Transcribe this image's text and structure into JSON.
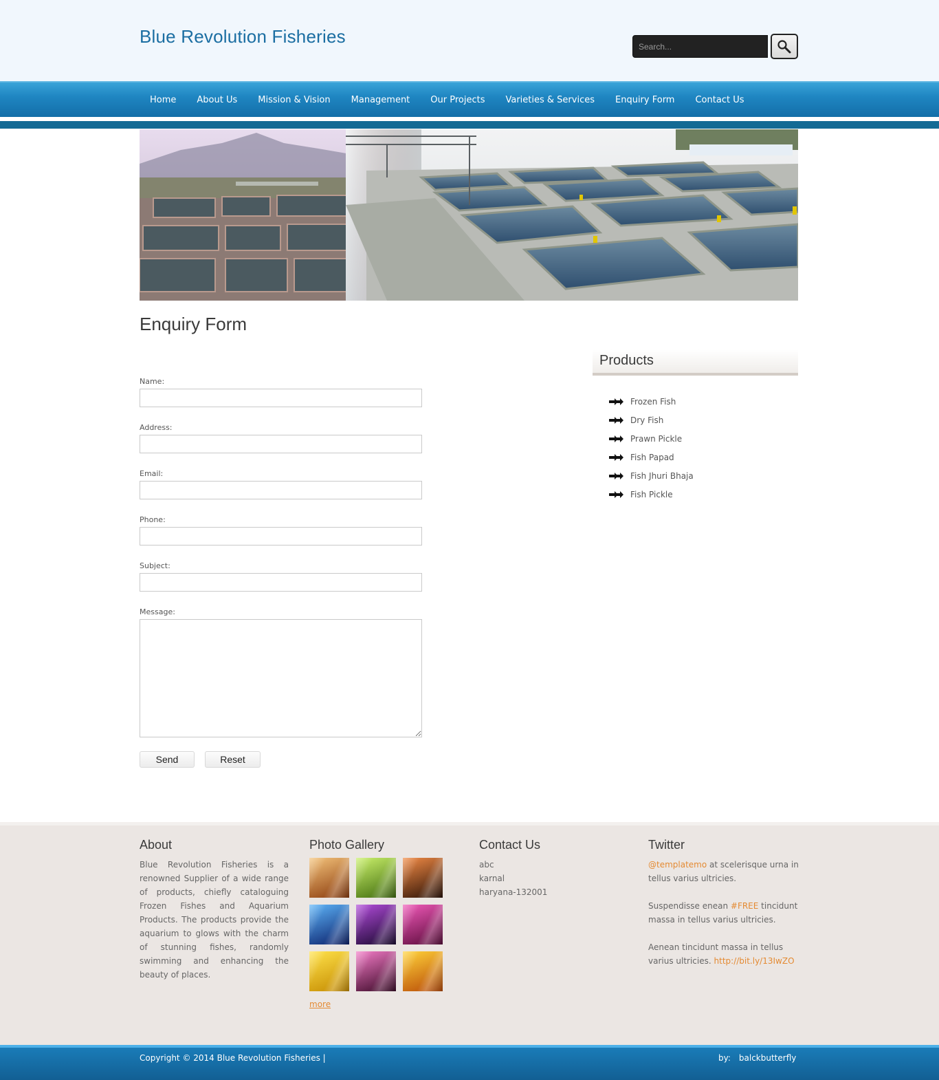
{
  "header": {
    "site_title": "Blue Revolution Fisheries",
    "search_placeholder": "Search..."
  },
  "nav": {
    "items": [
      "Home",
      "About Us",
      "Mission & Vision",
      "Management",
      "Our Projects",
      "Varieties & Services",
      "Enquiry Form",
      "Contact Us"
    ]
  },
  "main": {
    "heading": "Enquiry Form",
    "form": {
      "name_label": "Name:",
      "address_label": "Address:",
      "email_label": "Email:",
      "phone_label": "Phone:",
      "subject_label": "Subject:",
      "message_label": "Message:",
      "send_label": "Send",
      "reset_label": "Reset"
    }
  },
  "sidebar": {
    "title": "Products",
    "items": [
      "Frozen Fish",
      "Dry Fish",
      "Prawn Pickle",
      "Fish Papad",
      "Fish Jhuri Bhaja",
      "Fish Pickle"
    ]
  },
  "footer": {
    "about": {
      "heading": "About",
      "text": "Blue Revolution Fisheries is a renowned Supplier of a wide range of products, chiefly cataloguing Frozen Fishes and Aquarium Products. The products provide the aquarium to glows with the charm of stunning fishes, randomly swimming and enhancing the beauty of places."
    },
    "gallery": {
      "heading": "Photo Gallery",
      "more_label": "more",
      "thumb_colors": [
        [
          "#f3c27a",
          "#8a3a0c"
        ],
        [
          "#c9ef6a",
          "#3f6b0d"
        ],
        [
          "#f08a45",
          "#2a1005"
        ],
        [
          "#5db3f7",
          "#0a1f6a"
        ],
        [
          "#b04bd8",
          "#1a0830"
        ],
        [
          "#ef59b8",
          "#5a0a3a"
        ],
        [
          "#ffe24a",
          "#c48a00"
        ],
        [
          "#f27bc6",
          "#3a0826"
        ],
        [
          "#ffd23a",
          "#b84a06"
        ]
      ]
    },
    "contact": {
      "heading": "Contact Us",
      "lines": [
        "abc",
        "karnal",
        "haryana-132001"
      ]
    },
    "twitter": {
      "heading": "Twitter",
      "tweet1_link": "@templatemo",
      "tweet1_text": " at scelerisque urna in tellus varius ultricies.",
      "tweet2_pre": "Suspendisse enean ",
      "tweet2_link": "#FREE",
      "tweet2_post": " tincidunt massa in tellus varius ultricies.",
      "tweet3_text": "Aenean tincidunt massa in tellus varius ultricies. ",
      "tweet3_link": "http://bit.ly/13IwZO"
    },
    "copyright": "Copyright © 2014 Blue Revolution Fisheries |",
    "credit_by": "by:",
    "credit_name": "balckbutterfly"
  },
  "colors": {
    "brand_blue": "#1b6ea2",
    "nav_blue": "#1f86c2",
    "link_orange": "#e48a32",
    "footer_bg": "#ebe6e3"
  }
}
